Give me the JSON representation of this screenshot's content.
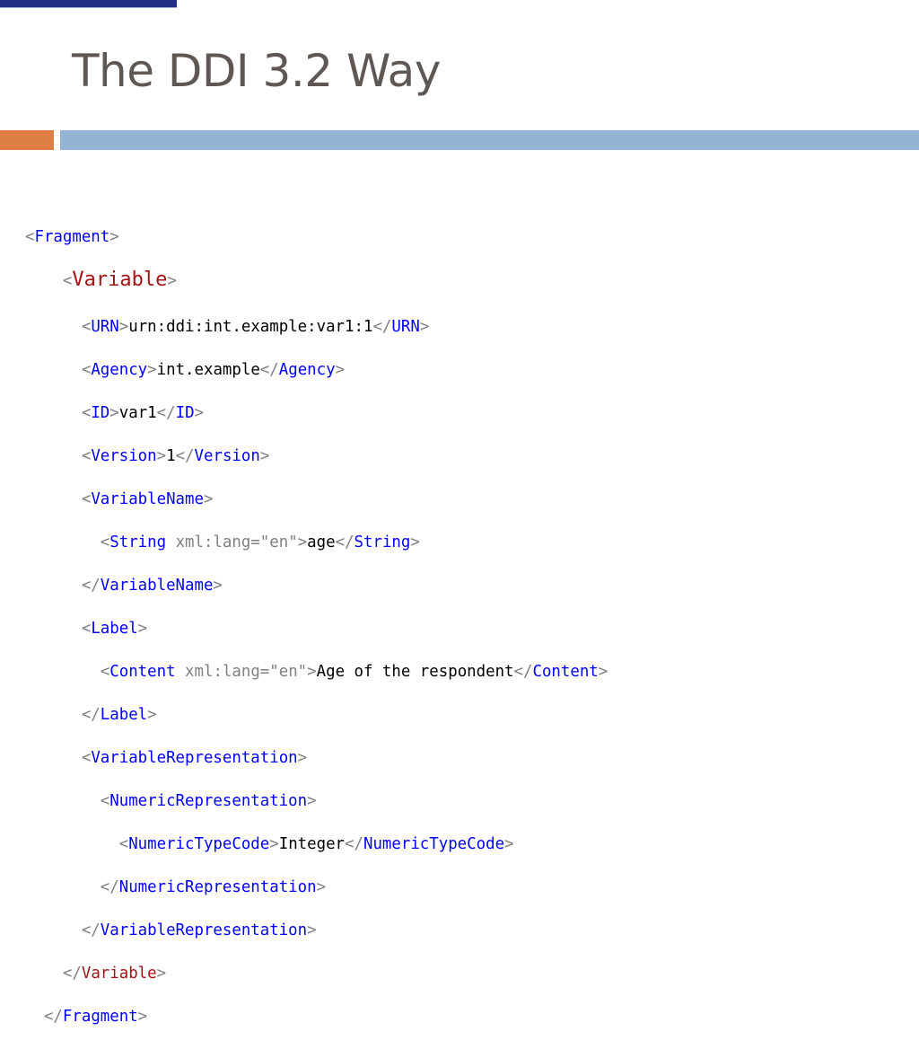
{
  "slide": {
    "title": "The DDI 3.2 Way"
  },
  "code": {
    "fragment": "Fragment",
    "variable": "Variable",
    "urn_tag": "URN",
    "urn_value": "urn:ddi:int.example:var1:1",
    "agency_tag": "Agency",
    "agency_value": "int.example",
    "id_tag": "ID",
    "id_value": "var1",
    "version_tag": "Version",
    "version_value": "1",
    "variablename_tag": "VariableName",
    "string_tag": "String",
    "lang_attr": "xml:lang=\"en\"",
    "string_value": "age",
    "label_tag": "Label",
    "content_tag": "Content",
    "content_value": "Age of the respondent",
    "varrep_tag": "VariableRepresentation",
    "numrep_tag": "NumericRepresentation",
    "numtype_tag": "NumericTypeCode",
    "numtype_value": "Integer"
  },
  "theme": {
    "navy": "#1f2f86",
    "orange": "#e07f44",
    "blue": "#95b3d4",
    "title_color": "#5f5753",
    "tag_color": "#0000ff",
    "variable_tag_color": "#a31515",
    "punctuation_color": "#808080"
  }
}
